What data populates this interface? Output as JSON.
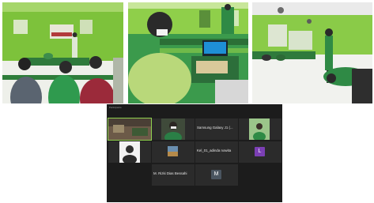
{
  "meeting": {
    "header": "Participants",
    "participants": [
      {
        "name": "",
        "kind": "video",
        "speaking": true
      },
      {
        "name": "",
        "kind": "video"
      },
      {
        "name": "Samsung Galaxy J1 (...",
        "kind": "name-only"
      },
      {
        "name": "",
        "kind": "video"
      },
      {
        "name": "",
        "kind": "video"
      },
      {
        "name": "",
        "kind": "image"
      },
      {
        "name": "Kel_01_adinda nowita",
        "kind": "name-only"
      },
      {
        "name": "",
        "kind": "avatar",
        "initial": "L",
        "color": "#7b3fb4"
      },
      {
        "name": "M. Rizki Dias Bessahi",
        "kind": "name-only"
      },
      {
        "name": "",
        "kind": "avatar",
        "initial": "M",
        "color": "#4a5560"
      }
    ]
  },
  "colors": {
    "wall": "#7ec53a",
    "floor": "#eef0ea",
    "uniform": "#3aa052",
    "meet_bg": "#1c1c1c",
    "tile_bg": "#2b2b2b"
  }
}
